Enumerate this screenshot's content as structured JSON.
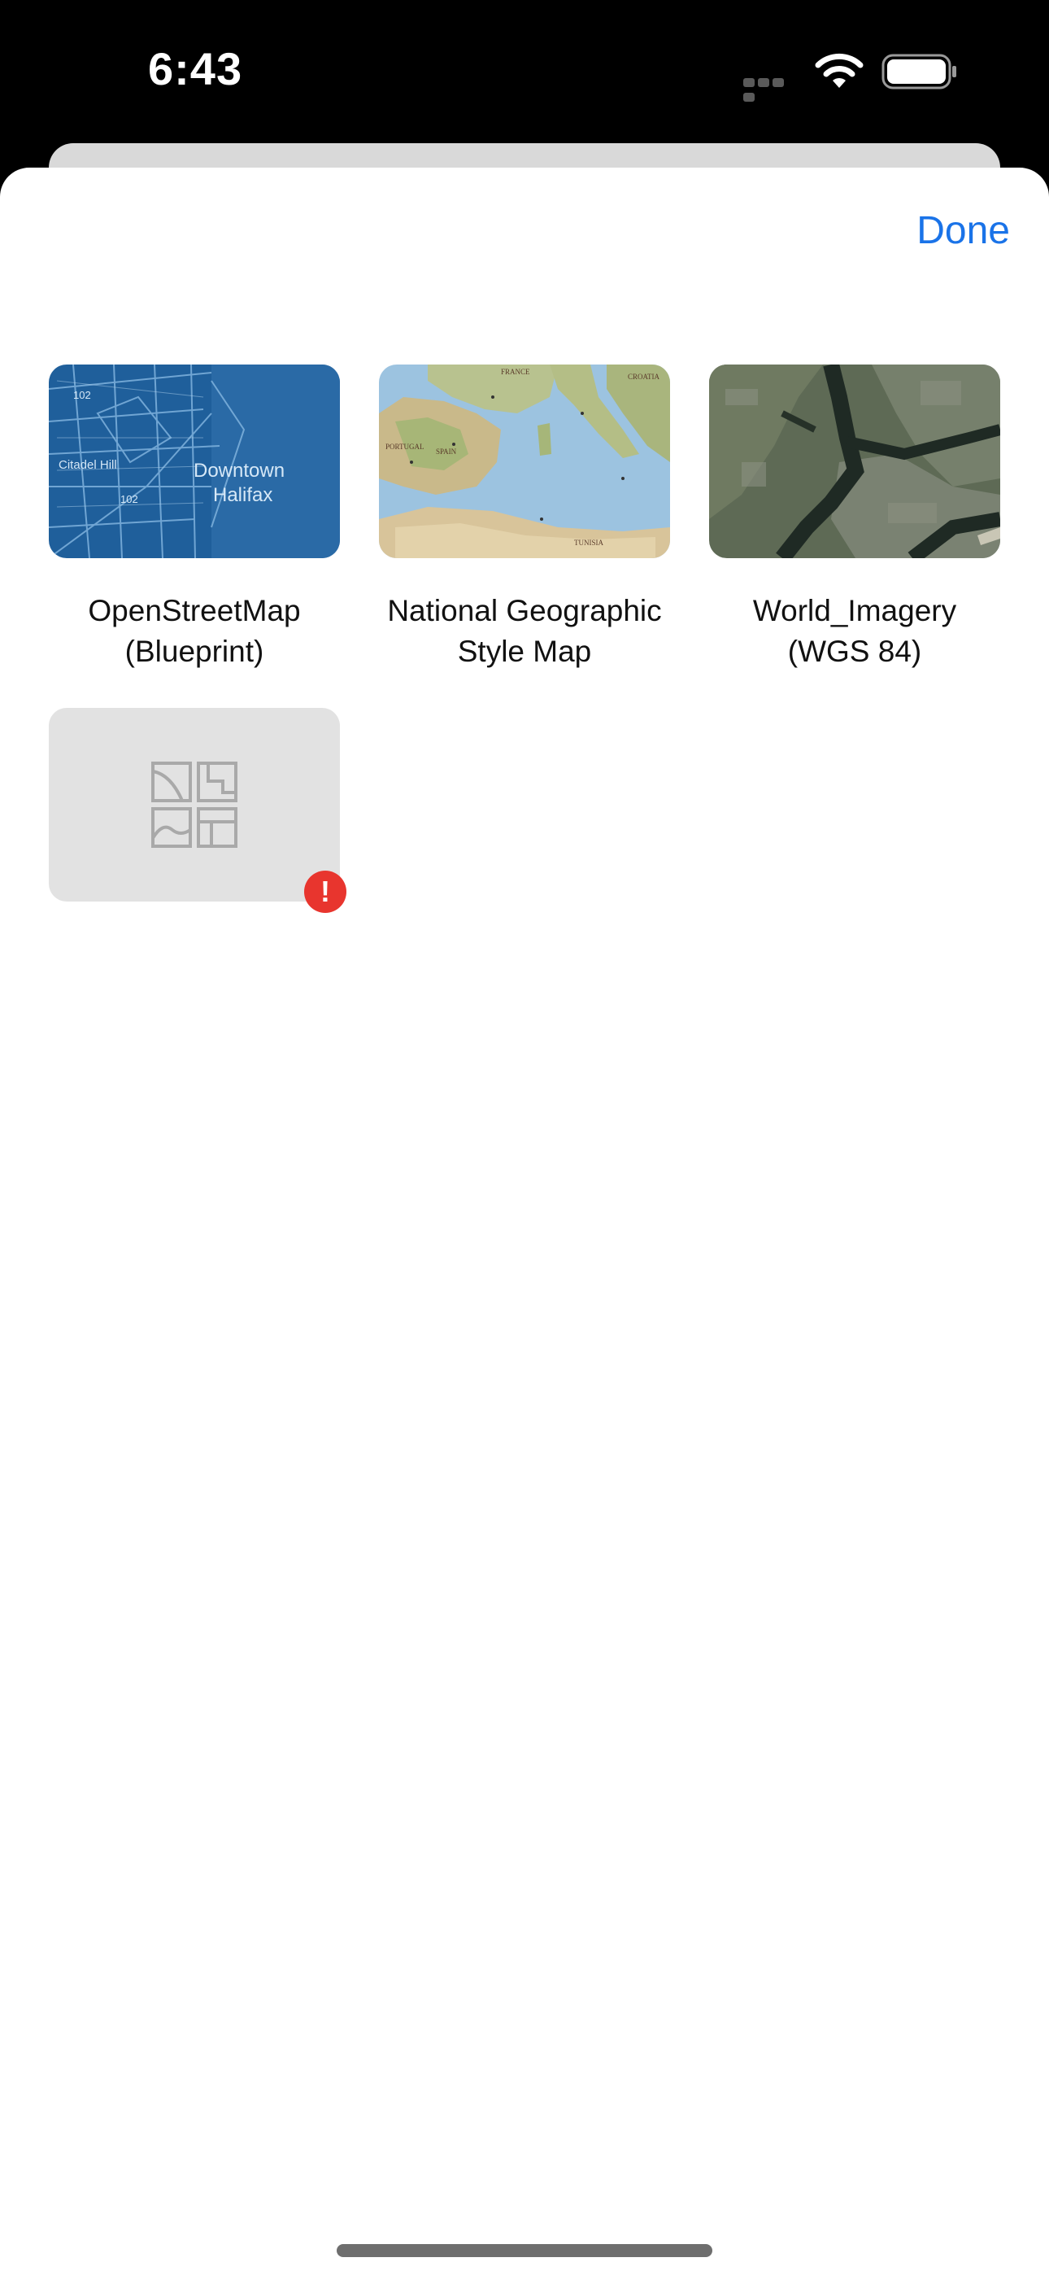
{
  "status_bar": {
    "time": "6:43"
  },
  "sheet": {
    "done_label": "Done"
  },
  "basemaps": [
    {
      "title": "OpenStreetMap\n(Blueprint)",
      "thumbnail": "blueprint-map",
      "labels": [
        "Citadel Hill",
        "Downtown",
        "Halifax",
        "102",
        "102"
      ]
    },
    {
      "title": "National Geographic\nStyle Map",
      "thumbnail": "natgeo-map",
      "labels": [
        "FRANCE",
        "CROATIA",
        "SPAIN",
        "PORTUGAL",
        "TUNISIA"
      ]
    },
    {
      "title": "World_Imagery\n(WGS 84)",
      "thumbnail": "satellite-imagery"
    },
    {
      "title": "",
      "thumbnail": "placeholder-basemap-icon",
      "error": "!"
    }
  ],
  "colors": {
    "accent": "#1a73e8",
    "error": "#e8352e",
    "blueprint": "#1f5f9b"
  }
}
